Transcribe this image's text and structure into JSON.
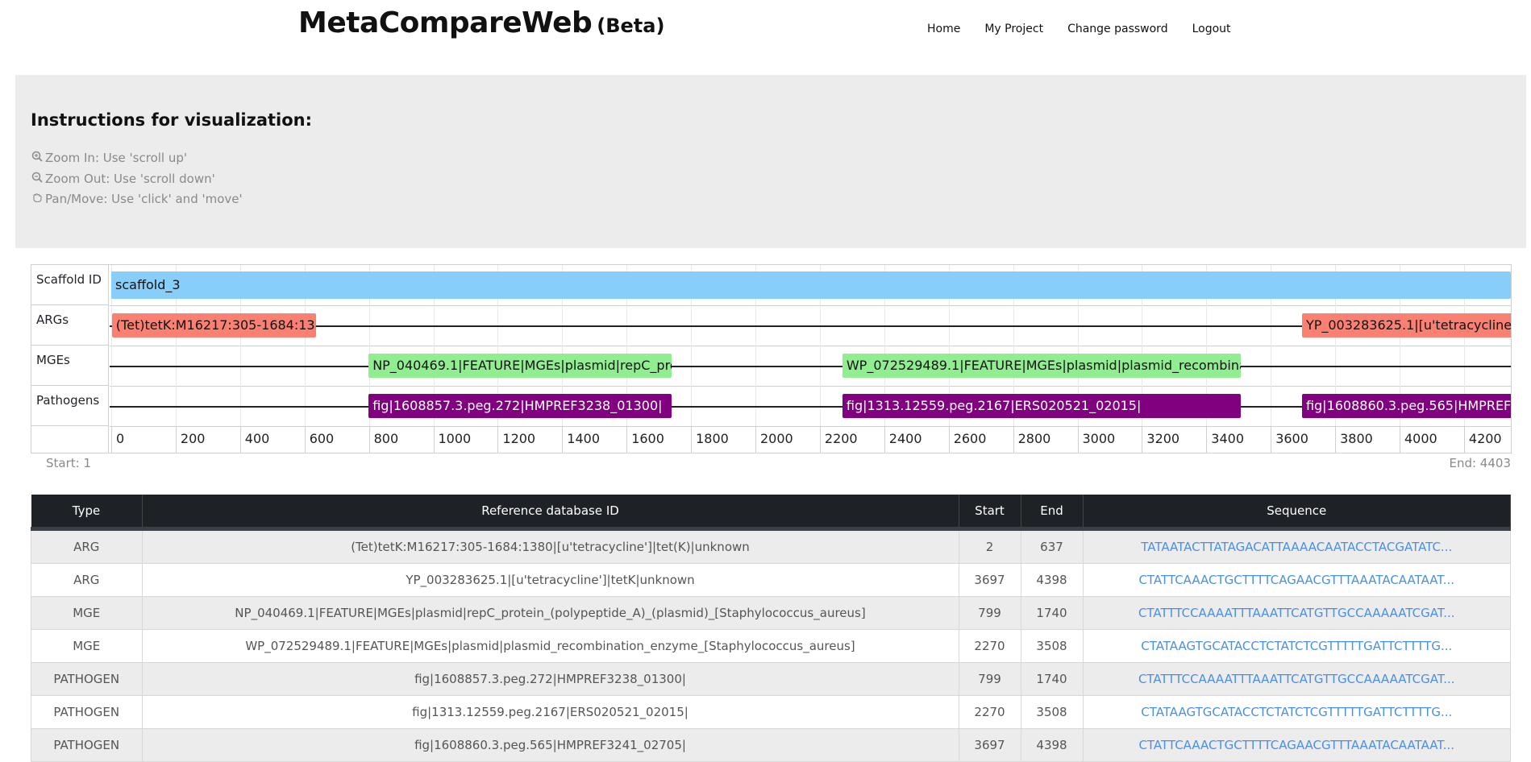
{
  "brand": {
    "title": "MetaCompareWeb",
    "beta": "(Beta)"
  },
  "nav": [
    {
      "label": "Home"
    },
    {
      "label": "My Project"
    },
    {
      "label": "Change password"
    },
    {
      "label": "Logout"
    }
  ],
  "instructions": {
    "title": "Instructions for visualization:",
    "items": [
      {
        "icon": "zoom-in-icon",
        "text": "Zoom In: Use 'scroll up'"
      },
      {
        "icon": "zoom-out-icon",
        "text": "Zoom Out: Use 'scroll down'"
      },
      {
        "icon": "hand-icon",
        "text": "Pan/Move: Use 'click' and 'move'"
      }
    ]
  },
  "viz": {
    "rows": {
      "scaffold": "Scaffold ID",
      "args": "ARGs",
      "mges": "MGEs",
      "pathogens": "Pathogens"
    },
    "scaffold_label": "scaffold_3",
    "axis_ticks": [
      "0",
      "200",
      "400",
      "600",
      "800",
      "1000",
      "1200",
      "1400",
      "1600",
      "1800",
      "2000",
      "2200",
      "2400",
      "2600",
      "2800",
      "3000",
      "3200",
      "3400",
      "3600",
      "3800",
      "4000",
      "4200"
    ],
    "start_text": "Start: 1",
    "end_text": "End: 4403",
    "colors": {
      "scaffold": "#87cefa",
      "arg": "#fa8072",
      "mge": "#90ee90",
      "pathogen": "#800080"
    }
  },
  "table": {
    "headers": [
      "Type",
      "Reference database ID",
      "Start",
      "End",
      "Sequence"
    ],
    "rows": [
      {
        "type": "ARG",
        "ref": "(Tet)tetK:M16217:305-1684:1380|[u'tetracycline']|tet(K)|unknown",
        "start": "2",
        "end": "637",
        "seq": "TATAATACTTATAGACATTAAAACAATACCTACGATATC..."
      },
      {
        "type": "ARG",
        "ref": "YP_003283625.1|[u'tetracycline']|tetK|unknown",
        "start": "3697",
        "end": "4398",
        "seq": "CTATTCAAACTGCTTTTCAGAACGTTTAAATACAATAAT..."
      },
      {
        "type": "MGE",
        "ref": "NP_040469.1|FEATURE|MGEs|plasmid|repC_protein_(polypeptide_A)_(plasmid)_[Staphylococcus_aureus]",
        "start": "799",
        "end": "1740",
        "seq": "CTATTTCCAAAATTTAAATTCATGTTGCCAAAAATCGAT..."
      },
      {
        "type": "MGE",
        "ref": "WP_072529489.1|FEATURE|MGEs|plasmid|plasmid_recombination_enzyme_[Staphylococcus_aureus]",
        "start": "2270",
        "end": "3508",
        "seq": "CTATAAGTGCATACCTCTATCTCGTTTTTGATTCTTTTG..."
      },
      {
        "type": "PATHOGEN",
        "ref": "fig|1608857.3.peg.272|HMPREF3238_01300|",
        "start": "799",
        "end": "1740",
        "seq": "CTATTTCCAAAATTTAAATTCATGTTGCCAAAAATCGAT..."
      },
      {
        "type": "PATHOGEN",
        "ref": "fig|1313.12559.peg.2167|ERS020521_02015|",
        "start": "2270",
        "end": "3508",
        "seq": "CTATAAGTGCATACCTCTATCTCGTTTTTGATTCTTTTG..."
      },
      {
        "type": "PATHOGEN",
        "ref": "fig|1608860.3.peg.565|HMPREF3241_02705|",
        "start": "3697",
        "end": "4398",
        "seq": "CTATTCAAACTGCTTTTCAGAACGTTTAAATACAATAAT..."
      }
    ]
  }
}
